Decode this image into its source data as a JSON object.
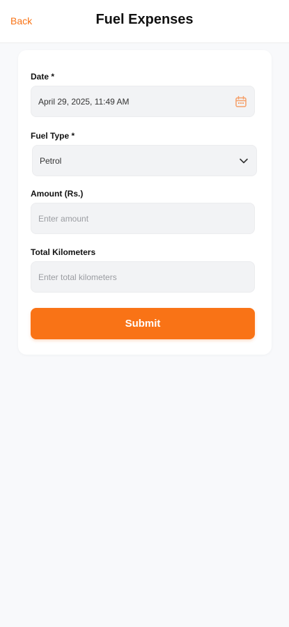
{
  "header": {
    "back_label": "Back",
    "title": "Fuel Expenses"
  },
  "form": {
    "date": {
      "label": "Date *",
      "value": "April 29, 2025, 11:49 AM",
      "icon": "calendar-icon"
    },
    "fuel_type": {
      "label": "Fuel Type *",
      "selected": "Petrol",
      "icon": "chevron-down-icon"
    },
    "amount": {
      "label": "Amount (Rs.)",
      "placeholder": "Enter amount"
    },
    "total_km": {
      "label": "Total Kilometers",
      "placeholder": "Enter total kilometers"
    },
    "submit_label": "Submit"
  },
  "colors": {
    "accent": "#f97316",
    "background": "#f8f9fb",
    "field_bg": "#f2f3f5"
  }
}
